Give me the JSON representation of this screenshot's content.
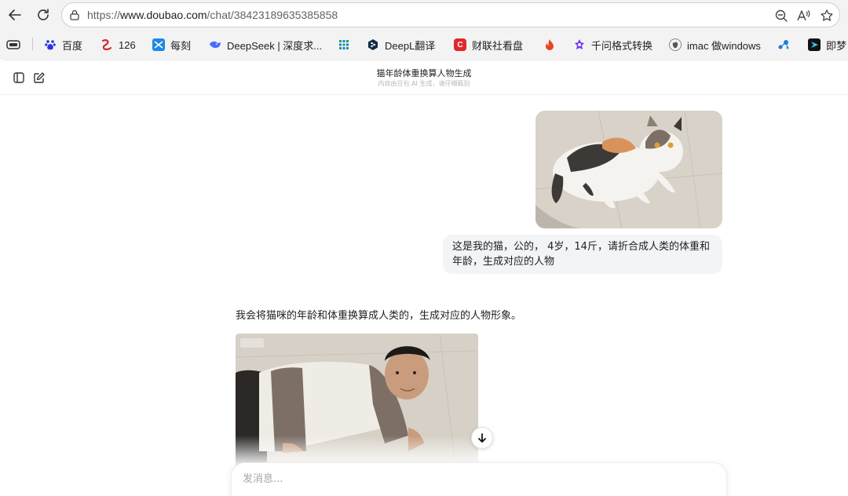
{
  "browser": {
    "url_prefix": "https://",
    "url_host": "www.doubao.com",
    "url_path": "/chat/38423189635385858",
    "bookmarks": [
      {
        "label": "",
        "icon": "tab-icon"
      },
      {
        "label": "百度",
        "icon": "baidu-paw-icon",
        "color": "#2932e1"
      },
      {
        "label": "126",
        "icon": "mail-126-icon",
        "color": "#d3282d"
      },
      {
        "label": "每刻",
        "icon": "meike-icon",
        "color": "#1e88e5"
      },
      {
        "label": "DeepSeek | 深度求...",
        "icon": "deepseek-whale-icon",
        "color": "#4d6bfe"
      },
      {
        "label": "",
        "icon": "grid-icon",
        "color": "#1a9e6f"
      },
      {
        "label": "DeepL翻译",
        "icon": "deepl-icon",
        "color": "#0f2b46"
      },
      {
        "label": "财联社看盘",
        "icon": "cls-icon",
        "color": "#e0282d"
      },
      {
        "label": "",
        "icon": "fire-icon",
        "color": "#e8451f"
      },
      {
        "label": "千问格式转换",
        "icon": "qianwen-icon",
        "color": "#6b3cf0"
      },
      {
        "label": "imac 做windows",
        "icon": "apple-icon",
        "color": "#555555"
      },
      {
        "label": "",
        "icon": "molecule-icon",
        "color": "#1e7bd9"
      },
      {
        "label": "即梦",
        "icon": "jimeng-icon",
        "color": "#111111"
      }
    ]
  },
  "chat": {
    "title": "猫年龄体重换算人物生成",
    "subtitle": "内容由豆包 AI 生成，请仔细甄别",
    "user_message": "这是我的猫，公的， 4岁，14斤，请折合成人类的体重和年龄，生成对应的人物",
    "bot_message": "我会将猫咪的年龄和体重换算成人类的，生成对应的人物形象。",
    "composer_placeholder": "发消息..."
  }
}
